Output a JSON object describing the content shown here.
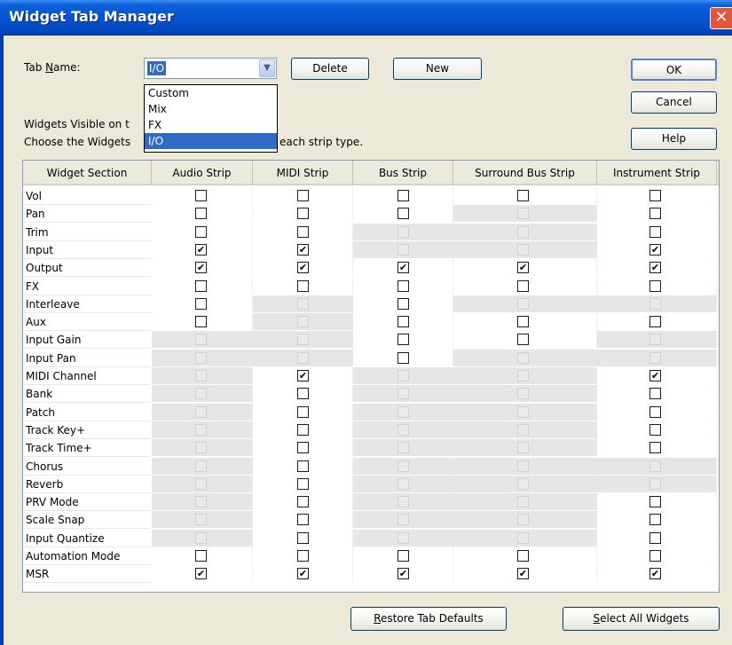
{
  "window": {
    "title": "Widget Tab Manager",
    "close_glyph": "✕"
  },
  "form": {
    "tab_name_label_pre": "Tab ",
    "tab_name_label_ul": "N",
    "tab_name_label_post": "ame:",
    "tab_name_value": "I/O",
    "dropdown_options": [
      "Custom",
      "Mix",
      "FX",
      "I/O"
    ],
    "selected_option_index": 3,
    "visible_line_1": "Widgets Visible on t",
    "visible_line_2_pre": "Choose the Widgets",
    "visible_line_2_post": "each strip type."
  },
  "buttons": {
    "delete": "Delete",
    "new": "New",
    "ok": "OK",
    "cancel": "Cancel",
    "help": "Help",
    "restore_ul": "R",
    "restore_rest": "estore Tab Defaults",
    "select_all_ul": "S",
    "select_all_rest": "elect All Widgets"
  },
  "table": {
    "columns": [
      "Widget Section",
      "Audio Strip",
      "MIDI Strip",
      "Bus Strip",
      "Surround Bus Strip",
      "Instrument Strip"
    ],
    "check_glyph": "✔",
    "rows": [
      {
        "label": "Vol",
        "cells": [
          0,
          0,
          0,
          0,
          0
        ]
      },
      {
        "label": "Pan",
        "cells": [
          0,
          0,
          0,
          -1,
          0
        ]
      },
      {
        "label": "Trim",
        "cells": [
          0,
          0,
          -1,
          -1,
          0
        ]
      },
      {
        "label": "Input",
        "cells": [
          1,
          1,
          -1,
          -1,
          1
        ]
      },
      {
        "label": "Output",
        "cells": [
          1,
          1,
          1,
          1,
          1
        ]
      },
      {
        "label": "FX",
        "cells": [
          0,
          0,
          0,
          0,
          0
        ]
      },
      {
        "label": "Interleave",
        "cells": [
          0,
          -1,
          0,
          -1,
          -1
        ]
      },
      {
        "label": "Aux",
        "cells": [
          0,
          -1,
          0,
          0,
          0
        ]
      },
      {
        "label": "Input Gain",
        "cells": [
          -1,
          -1,
          0,
          0,
          -1
        ]
      },
      {
        "label": "Input Pan",
        "cells": [
          -1,
          -1,
          0,
          -1,
          -1
        ]
      },
      {
        "label": "MIDI Channel",
        "cells": [
          -1,
          1,
          -1,
          -1,
          1
        ]
      },
      {
        "label": "Bank",
        "cells": [
          -1,
          0,
          -1,
          -1,
          0
        ]
      },
      {
        "label": "Patch",
        "cells": [
          -1,
          0,
          -1,
          -1,
          0
        ]
      },
      {
        "label": "Track Key+",
        "cells": [
          -1,
          0,
          -1,
          -1,
          0
        ]
      },
      {
        "label": "Track Time+",
        "cells": [
          -1,
          0,
          -1,
          -1,
          0
        ]
      },
      {
        "label": "Chorus",
        "cells": [
          -1,
          0,
          -1,
          -1,
          -1
        ]
      },
      {
        "label": "Reverb",
        "cells": [
          -1,
          0,
          -1,
          -1,
          -1
        ]
      },
      {
        "label": "PRV Mode",
        "cells": [
          -1,
          0,
          -1,
          -1,
          0
        ]
      },
      {
        "label": "Scale Snap",
        "cells": [
          -1,
          0,
          -1,
          -1,
          0
        ]
      },
      {
        "label": "Input Quantize",
        "cells": [
          -1,
          0,
          -1,
          -1,
          0
        ]
      },
      {
        "label": "Automation Mode",
        "cells": [
          0,
          0,
          0,
          0,
          0
        ]
      },
      {
        "label": "MSR",
        "cells": [
          1,
          1,
          1,
          1,
          1
        ]
      }
    ]
  }
}
